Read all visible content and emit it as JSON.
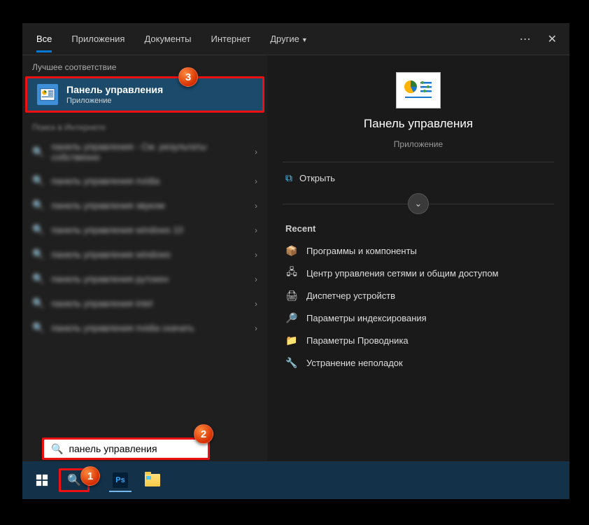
{
  "tabs": {
    "all": "Все",
    "apps": "Приложения",
    "docs": "Документы",
    "web": "Интернет",
    "more": "Другие"
  },
  "sections": {
    "best_match": "Лучшее соответствие",
    "web_search": "Поиск в Интернете"
  },
  "best_match": {
    "title": "Панель управления",
    "subtitle": "Приложение"
  },
  "web_results": [
    "панель управления - См. результаты собственно",
    "панель управления nvidia",
    "панель управления звуком",
    "панель управления windows 10",
    "панель управления windows",
    "панель управления рутокен",
    "панель управления intel",
    "панель управления nvidia скачать"
  ],
  "preview": {
    "title": "Панель управления",
    "subtitle": "Приложение",
    "open": "Открыть",
    "recent_label": "Recent",
    "recent": [
      {
        "icon": "programs-icon",
        "label": "Программы и компоненты"
      },
      {
        "icon": "network-icon",
        "label": "Центр управления сетями и общим доступом"
      },
      {
        "icon": "devices-icon",
        "label": "Диспетчер устройств"
      },
      {
        "icon": "indexing-icon",
        "label": "Параметры индексирования"
      },
      {
        "icon": "explorer-options-icon",
        "label": "Параметры Проводника"
      },
      {
        "icon": "troubleshoot-icon",
        "label": "Устранение неполадок"
      }
    ]
  },
  "search_input": "панель управления",
  "badges": {
    "b1": "1",
    "b2": "2",
    "b3": "3"
  }
}
